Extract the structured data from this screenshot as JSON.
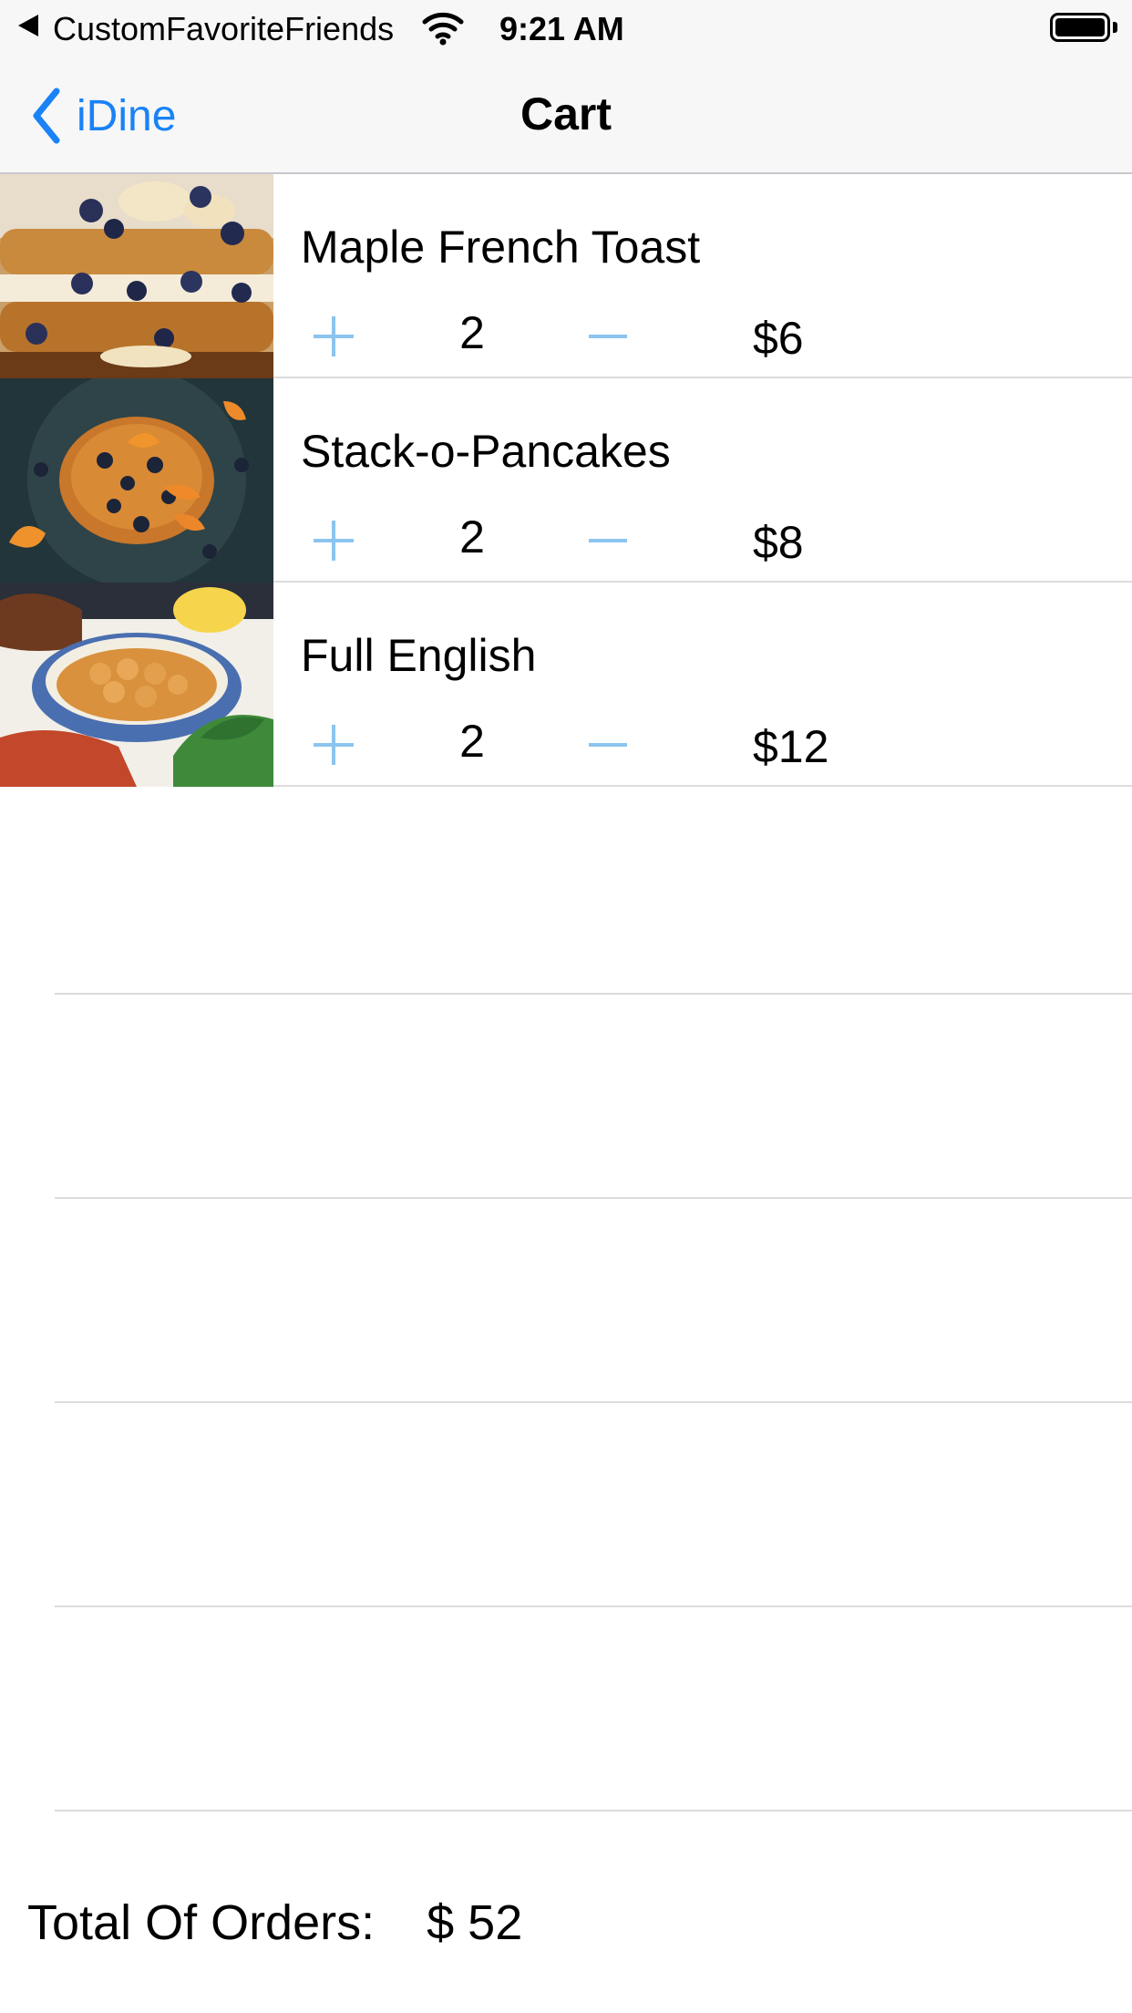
{
  "status_bar": {
    "carrier": "CustomFavoriteFriends",
    "time": "9:21 AM"
  },
  "nav": {
    "back_label": "iDine",
    "title": "Cart"
  },
  "cart": {
    "items": [
      {
        "name": "Maple French Toast",
        "quantity": "2",
        "price": "$6"
      },
      {
        "name": "Stack-o-Pancakes",
        "quantity": "2",
        "price": "$8"
      },
      {
        "name": "Full English",
        "quantity": "2",
        "price": "$12"
      }
    ]
  },
  "total": {
    "label": "Total Of Orders:",
    "value": "$ 52"
  },
  "colors": {
    "accent": "#1a82f7",
    "stepper": "#8cc4f0",
    "separator": "#dcdcdc",
    "bar_background": "#f7f7f7"
  },
  "icons": {
    "back": "chevron-left-icon",
    "increment": "plus-icon",
    "decrement": "minus-icon",
    "wifi": "wifi-icon",
    "battery": "battery-icon"
  }
}
